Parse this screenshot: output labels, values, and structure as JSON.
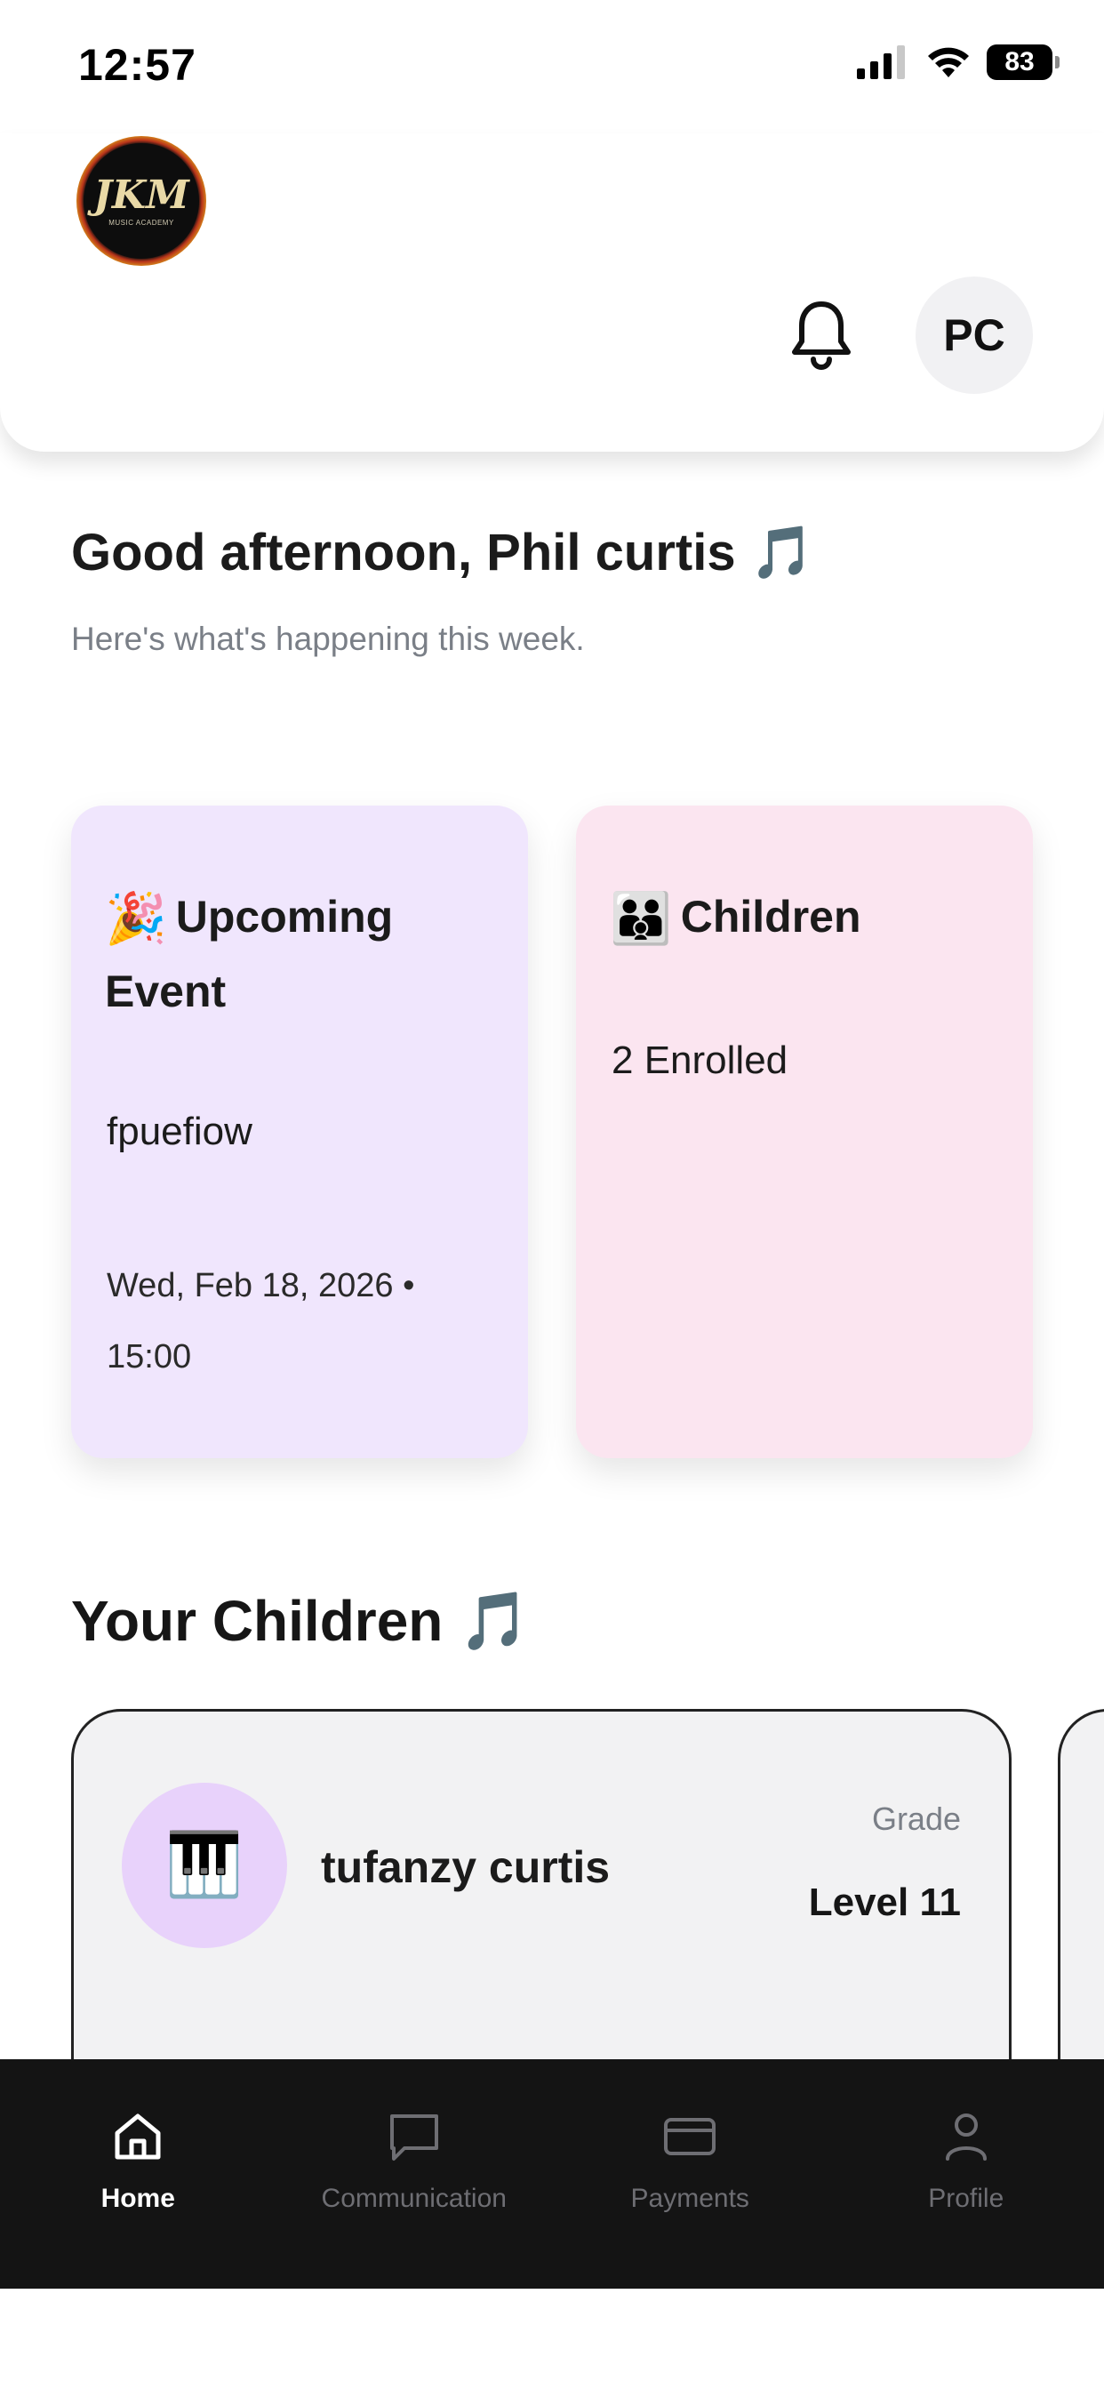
{
  "status_bar": {
    "time": "12:57",
    "battery": "83"
  },
  "header": {
    "avatar_initials": "PC",
    "logo_text": "JKM",
    "logo_subtext": "MUSIC ACADEMY"
  },
  "greeting": {
    "title": "Good afternoon, Phil curtis 🎵",
    "subtitle": "Here's what's happening this week."
  },
  "cards": {
    "event": {
      "emoji": "🎉",
      "title": "Upcoming Event",
      "name": "fpuefiow",
      "datetime": "Wed, Feb 18, 2026 • 15:00"
    },
    "children": {
      "emoji": "👪",
      "title": "Children",
      "count": "2 Enrolled"
    }
  },
  "children_section": {
    "title": "Your Children 🎵",
    "children": [
      {
        "icon": "🎹",
        "name": "tufanzy curtis",
        "grade_label": "Grade",
        "grade": "Level 11"
      }
    ]
  },
  "nav": {
    "items": [
      {
        "label": "Home",
        "icon": "home-icon",
        "active": true
      },
      {
        "label": "Communication",
        "icon": "chat-icon",
        "active": false
      },
      {
        "label": "Payments",
        "icon": "card-icon",
        "active": false
      },
      {
        "label": "Profile",
        "icon": "user-icon",
        "active": false
      }
    ]
  },
  "colors": {
    "event_card": "#f0e6fd",
    "children_card": "#fbe5f0",
    "child_avatar": "#e8d2fb",
    "nav_background": "#141414"
  }
}
